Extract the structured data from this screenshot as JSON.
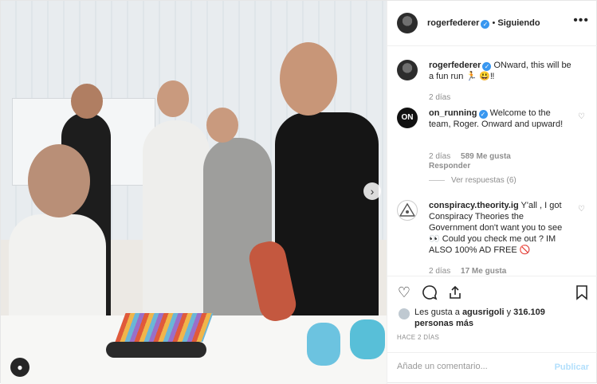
{
  "header": {
    "username": "rogerfederer",
    "separator": "•",
    "follow_label": "Siguiendo",
    "more_icon": "more-dots-icon"
  },
  "caption": {
    "username": "rogerfederer",
    "text": "ONward, this will be a fun run 🏃 😃‼",
    "time": "2 días"
  },
  "comments": [
    {
      "username": "on_running",
      "text": "Welcome to the team, Roger. Onward and upward!",
      "time": "2 días",
      "likes": "589 Me gusta",
      "reply_label": "Responder",
      "view_replies": "Ver respuestas (6)"
    },
    {
      "username": "conspiracy.theority.ig",
      "text": "Y'all , I got Conspiracy Theories the Government don't want you to see 👀 Could you check me out ? IM ALSO 100% AD FREE 🚫",
      "time": "2 días",
      "likes": "17 Me gusta"
    }
  ],
  "actions": {
    "like_icon": "heart-icon",
    "comment_icon": "comment-icon",
    "share_icon": "share-icon",
    "save_icon": "bookmark-icon"
  },
  "likes": {
    "prefix": "Les gusta a",
    "user": "agusrigoli",
    "connector": "y",
    "count": "316.109 personas más"
  },
  "timestamp": "HACE 2 DÍAS",
  "add_comment": {
    "placeholder": "Añade un comentario...",
    "publish_label": "Publicar"
  },
  "colors": {
    "verified": "#3897f0",
    "publish_disabled": "#b2dffc",
    "secondary_text": "#8e8e8e"
  }
}
